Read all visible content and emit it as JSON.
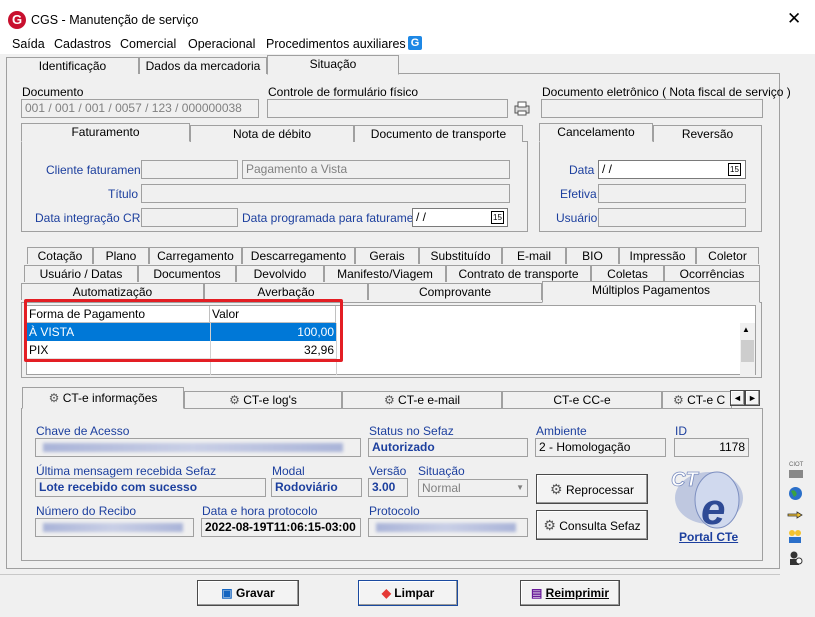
{
  "window": {
    "app_icon": "G",
    "title": "CGS - Manutenção de serviço",
    "close": "✕"
  },
  "menu": [
    "Saída",
    "Cadastros",
    "Comercial",
    "Operacional",
    "Procedimentos auxiliares"
  ],
  "menu_icon": "G",
  "top_tabs": [
    "Identificação",
    "Dados da mercadoria",
    "Situação"
  ],
  "top_tabs_underline": [
    "f",
    "m",
    ""
  ],
  "document": {
    "label": "Documento",
    "value": "001 / 001 / 001 / 0057 / 123 / 000000038",
    "control_label": "Controle de formulário físico",
    "control_value": "",
    "edoc_label": "Documento eletrônico ( Nota fiscal de serviço )",
    "edoc_value": ""
  },
  "billing_tabs": [
    "Faturamento",
    "Nota de débito",
    "Documento de transporte"
  ],
  "billing": {
    "client_label": "Cliente faturamento",
    "client_code": "",
    "client_value": "Pagamento a Vista",
    "title_label": "Título",
    "title_value": "",
    "crc_label": "Data integração CRC",
    "crc_value": "",
    "scheduled_label": "Data programada para faturamento",
    "scheduled_value": " /  /"
  },
  "cancel_tabs": [
    "Cancelamento",
    "Reversão"
  ],
  "cancel": {
    "date_label": "Data",
    "date_value": " /  /",
    "effective_label": "Efetiva",
    "user_label": "Usuário"
  },
  "mid_tabs_row1": [
    "Cotação",
    "Plano",
    "Carregamento",
    "Descarregamento",
    "Gerais",
    "Substituído",
    "E-mail",
    "BIO",
    "Impressão",
    "Coletor"
  ],
  "mid_tabs_row2": [
    "Usuário / Datas",
    "Documentos",
    "Devolvido",
    "Manifesto/Viagem",
    "Contrato de transporte",
    "Coletas",
    "Ocorrências"
  ],
  "mid_tabs_row3": [
    "Automatização",
    "Averbação",
    "Comprovante",
    "Múltiplos Pagamentos"
  ],
  "payments": {
    "headers": [
      "Forma de Pagamento",
      "Valor"
    ],
    "rows": [
      {
        "method": "À VISTA",
        "value": "100,00"
      },
      {
        "method": "PIX",
        "value": "32,96"
      }
    ],
    "highlight_color": "#e31e24"
  },
  "cte_tabs": [
    "CT-e informações",
    "CT-e log's",
    "CT-e e-mail",
    "CT-e CC-e",
    "CT-e C"
  ],
  "cte_tab_scroll": [
    "◄",
    "►"
  ],
  "cte": {
    "key_label": "Chave de Acesso",
    "status_label": "Status no Sefaz",
    "status_value": "Autorizado",
    "env_label": "Ambiente",
    "env_value": "2 - Homologação",
    "id_label": "ID",
    "id_value": "1178",
    "lastmsg_label": "Última mensagem recebida Sefaz",
    "lastmsg_value": "Lote recebido com sucesso",
    "modal_label": "Modal",
    "modal_value": "Rodoviário",
    "version_label": "Versão",
    "version_value": "3.00",
    "situation_label": "Situação",
    "situation_value": "Normal",
    "receipt_label": "Número do Recibo",
    "protocol_date_label": "Data e hora protocolo",
    "protocol_date_value": "2022-08-19T11:06:15-03:00",
    "protocol_label": "Protocolo",
    "reprocess_button": "Reprocessar",
    "consult_button": "Consulta Sefaz",
    "portal_link": "Portal CTe",
    "portal_logo": "CT e"
  },
  "side_icons": [
    "CIOT"
  ],
  "bottom_buttons": {
    "save": "Gravar",
    "clear": "Limpar",
    "reprint": "Reimprimir"
  }
}
